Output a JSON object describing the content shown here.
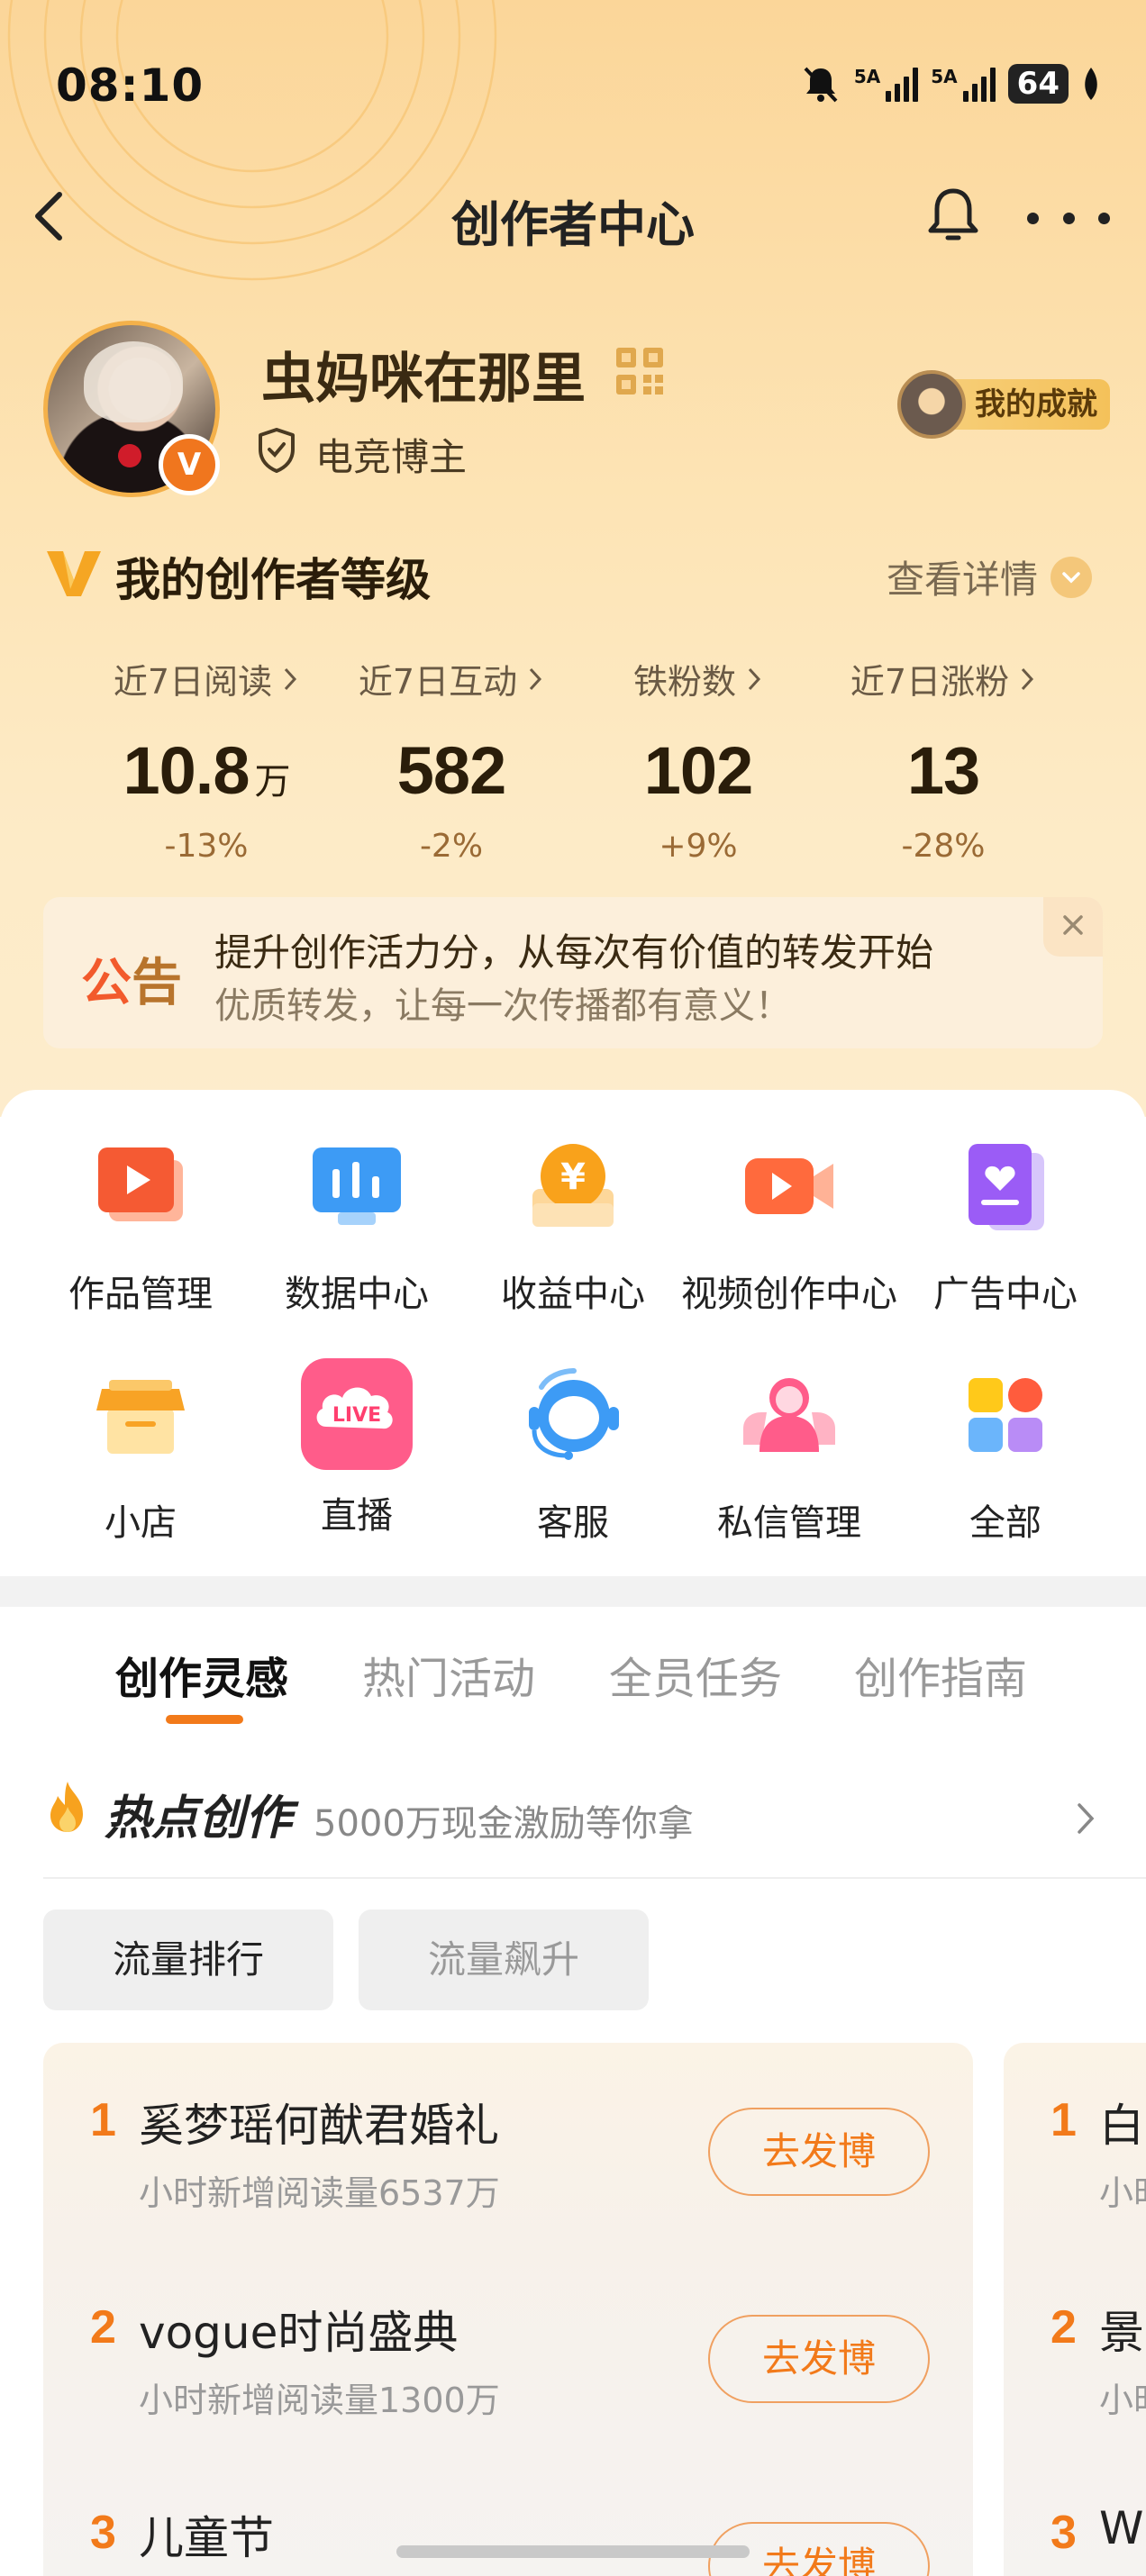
{
  "status": {
    "time": "08:10",
    "signal_1": "5A",
    "signal_2": "5A",
    "battery": "64"
  },
  "nav": {
    "title": "创作者中心"
  },
  "profile": {
    "name": "虫妈咪在那里",
    "tag": "电竞博主",
    "verified_badge": "V",
    "achievement": "我的成就"
  },
  "level": {
    "title": "我的创作者等级",
    "detail": "查看详情"
  },
  "stats": [
    {
      "label": "近7日阅读",
      "value": "10.8",
      "unit": "万",
      "change": "-13%"
    },
    {
      "label": "近7日互动",
      "value": "582",
      "unit": "",
      "change": "-2%"
    },
    {
      "label": "铁粉数",
      "value": "102",
      "unit": "",
      "change": "+9%"
    },
    {
      "label": "近7日涨粉",
      "value": "13",
      "unit": "",
      "change": "-28%"
    }
  ],
  "notice": {
    "tag_a": "公",
    "tag_b": "告",
    "line1": "提升创作活力分，从每次有价值的转发开始",
    "line2": "优质转发，让每一次传播都有意义！"
  },
  "tools": [
    {
      "label": "作品管理",
      "icon": "works-icon"
    },
    {
      "label": "数据中心",
      "icon": "data-icon"
    },
    {
      "label": "收益中心",
      "icon": "income-icon"
    },
    {
      "label": "视频创作中心",
      "icon": "video-icon"
    },
    {
      "label": "广告中心",
      "icon": "ad-icon"
    },
    {
      "label": "小店",
      "icon": "shop-icon"
    },
    {
      "label": "直播",
      "icon": "live-icon",
      "icon_text": "LIVE"
    },
    {
      "label": "客服",
      "icon": "service-icon"
    },
    {
      "label": "私信管理",
      "icon": "message-icon"
    },
    {
      "label": "全部",
      "icon": "all-icon"
    }
  ],
  "tabs": [
    "创作灵感",
    "热门活动",
    "全员任务",
    "创作指南"
  ],
  "hot": {
    "title": "热点创作",
    "subtitle": "5000万现金激励等你拿"
  },
  "filters": [
    "流量排行",
    "流量飙升"
  ],
  "cards": {
    "main": [
      {
        "rank": "1",
        "title": "奚梦瑶何猷君婚礼",
        "sub": "小时新增阅读量6537万",
        "button": "去发博"
      },
      {
        "rank": "2",
        "title": "vogue时尚盛典",
        "sub": "小时新增阅读量1300万",
        "button": "去发博"
      },
      {
        "rank": "3",
        "title": "儿童节",
        "sub": "",
        "button": "去发博"
      }
    ],
    "partial": [
      {
        "rank": "1",
        "title": "白",
        "sub": "小时"
      },
      {
        "rank": "2",
        "title": "景",
        "sub": "小时"
      },
      {
        "rank": "3",
        "title": "W",
        "sub": ""
      }
    ]
  },
  "colors": {
    "accent": "#f27a1a",
    "hero": "#fbd699",
    "tab_active": "#111111",
    "tab_inactive": "#999999"
  }
}
